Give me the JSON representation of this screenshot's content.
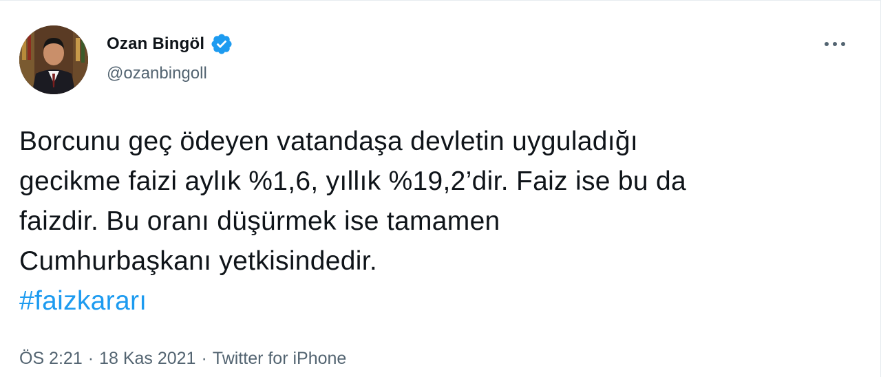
{
  "author": {
    "name": "Ozan Bingöl",
    "handle": "@ozanbingoll",
    "verified_color": "#1d9bf0"
  },
  "tweet": {
    "lines": [
      "Borcunu geç ödeyen vatandaşa devletin uyguladığı",
      "gecikme faizi aylık %1,6, yıllık %19,2’dir. Faiz ise bu da",
      "faizdir. Bu oranı düşürmek ise tamamen",
      "Cumhurbaşkanı yetkisindedir."
    ],
    "hashtag": "#faizkararı"
  },
  "meta": {
    "time": "ÖS 2:21",
    "separator": "·",
    "date": "18 Kas 2021",
    "source": "Twitter for iPhone"
  },
  "icons": {
    "more": "more-options-icon",
    "verified": "verified-badge-icon"
  }
}
